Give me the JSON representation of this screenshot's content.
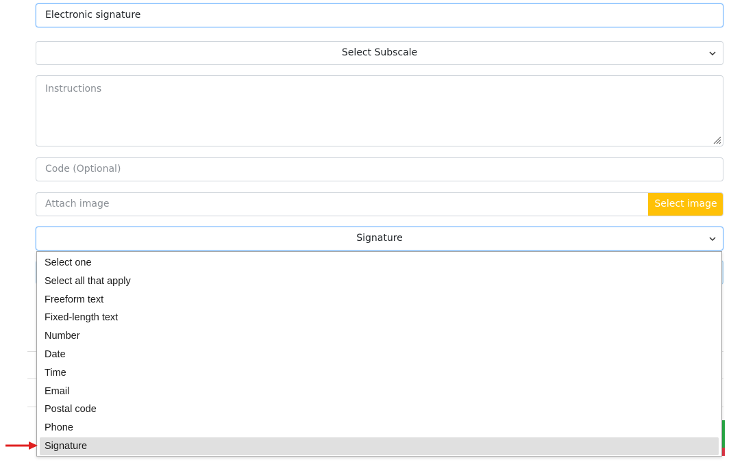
{
  "form": {
    "title_value": "Electronic signature",
    "subscale_select": {
      "selected": "Select Subscale"
    },
    "instructions_placeholder": "Instructions",
    "code_placeholder": "Code (Optional)",
    "attach_placeholder": "Attach image",
    "select_image_label": "Select image",
    "type_select": {
      "selected": "Signature",
      "options": [
        "Select one",
        "Select all that apply",
        "Freeform text",
        "Fixed-length text",
        "Number",
        "Date",
        "Time",
        "Email",
        "Postal code",
        "Phone",
        "Signature"
      ],
      "highlighted_index": 10
    }
  },
  "colors": {
    "accent_yellow": "#ffc107",
    "focus_border": "#80bdff",
    "annotation_arrow": "#e02020"
  }
}
